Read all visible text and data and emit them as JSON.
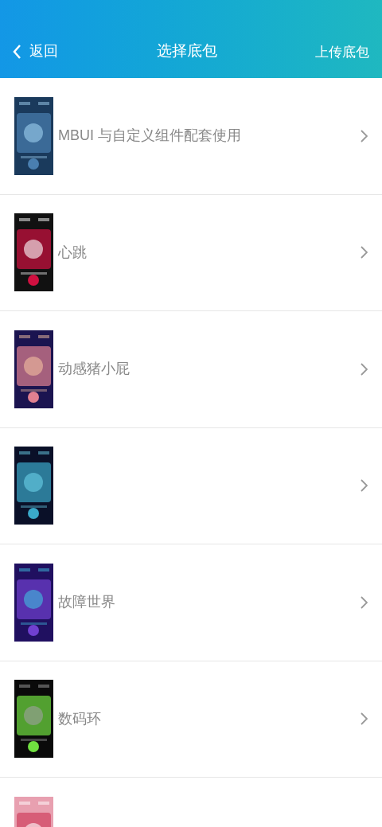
{
  "header": {
    "back_label": "返回",
    "title": "选择底包",
    "action": "上传底包"
  },
  "items": [
    {
      "kind": "picture",
      "label": "MBUI 与自定义组件配套使用",
      "chevron": true
    },
    {
      "kind": "picture",
      "label": "心跳",
      "chevron": true
    },
    {
      "kind": "picture",
      "label": "动感猪小屁",
      "chevron": true
    },
    {
      "kind": "picture",
      "chevron": true
    },
    {
      "kind": "picture",
      "label": "故障世界",
      "chevron": true
    },
    {
      "kind": "picture",
      "label": "数码环",
      "chevron": true
    },
    {
      "kind": "picture",
      "chevron": false
    }
  ]
}
